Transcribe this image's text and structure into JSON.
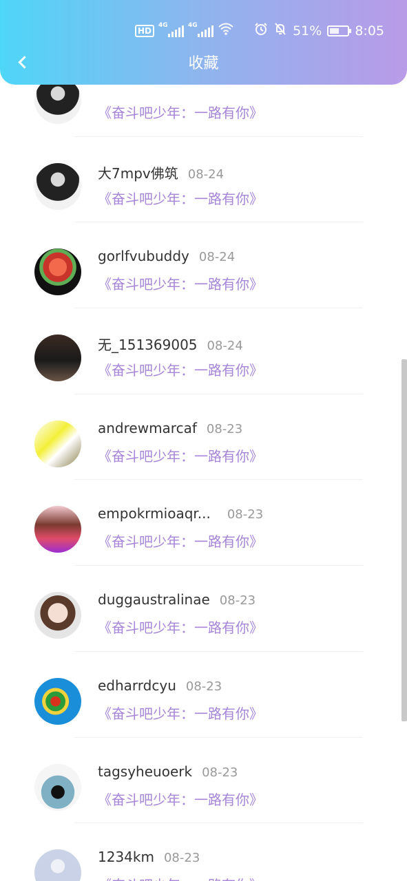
{
  "status_bar": {
    "hd_label": "HD",
    "net1": "4G",
    "net2": "4G",
    "battery_percent": "51%",
    "battery_level": 0.51,
    "time": "8:05",
    "icons": [
      "hd-icon",
      "signal-icon",
      "signal-icon",
      "wifi-icon",
      "alarm-icon",
      "mute-bell-icon",
      "battery-icon"
    ]
  },
  "nav": {
    "title": "收藏",
    "back_icon": "back-arrow-icon"
  },
  "list": {
    "items": [
      {
        "name": "",
        "date": "",
        "show": "《奋斗吧少年：一路有你》"
      },
      {
        "name": "大7mpv佛筑",
        "date": "08-24",
        "show": "《奋斗吧少年：一路有你》"
      },
      {
        "name": "gorlfvubuddy",
        "date": "08-24",
        "show": "《奋斗吧少年：一路有你》"
      },
      {
        "name": "无_151369005",
        "date": "08-24",
        "show": "《奋斗吧少年：一路有你》"
      },
      {
        "name": "andrewmarcaf",
        "date": "08-23",
        "show": "《奋斗吧少年：一路有你》"
      },
      {
        "name": "empokrmioaqr...",
        "date": "08-23",
        "show": "《奋斗吧少年：一路有你》"
      },
      {
        "name": "duggaustralinae",
        "date": "08-23",
        "show": "《奋斗吧少年：一路有你》"
      },
      {
        "name": "edharrdcyu",
        "date": "08-23",
        "show": "《奋斗吧少年：一路有你》"
      },
      {
        "name": "tagsyheuoerk",
        "date": "08-23",
        "show": "《奋斗吧少年：一路有你》"
      },
      {
        "name": "1234km",
        "date": "08-23",
        "show": "《奋斗吧少年：一路有你》"
      }
    ]
  },
  "colors": {
    "header_gradient_start": "#4ed6f8",
    "header_gradient_end": "#b99be8",
    "show_title": "#a684d8",
    "date": "#999999"
  }
}
